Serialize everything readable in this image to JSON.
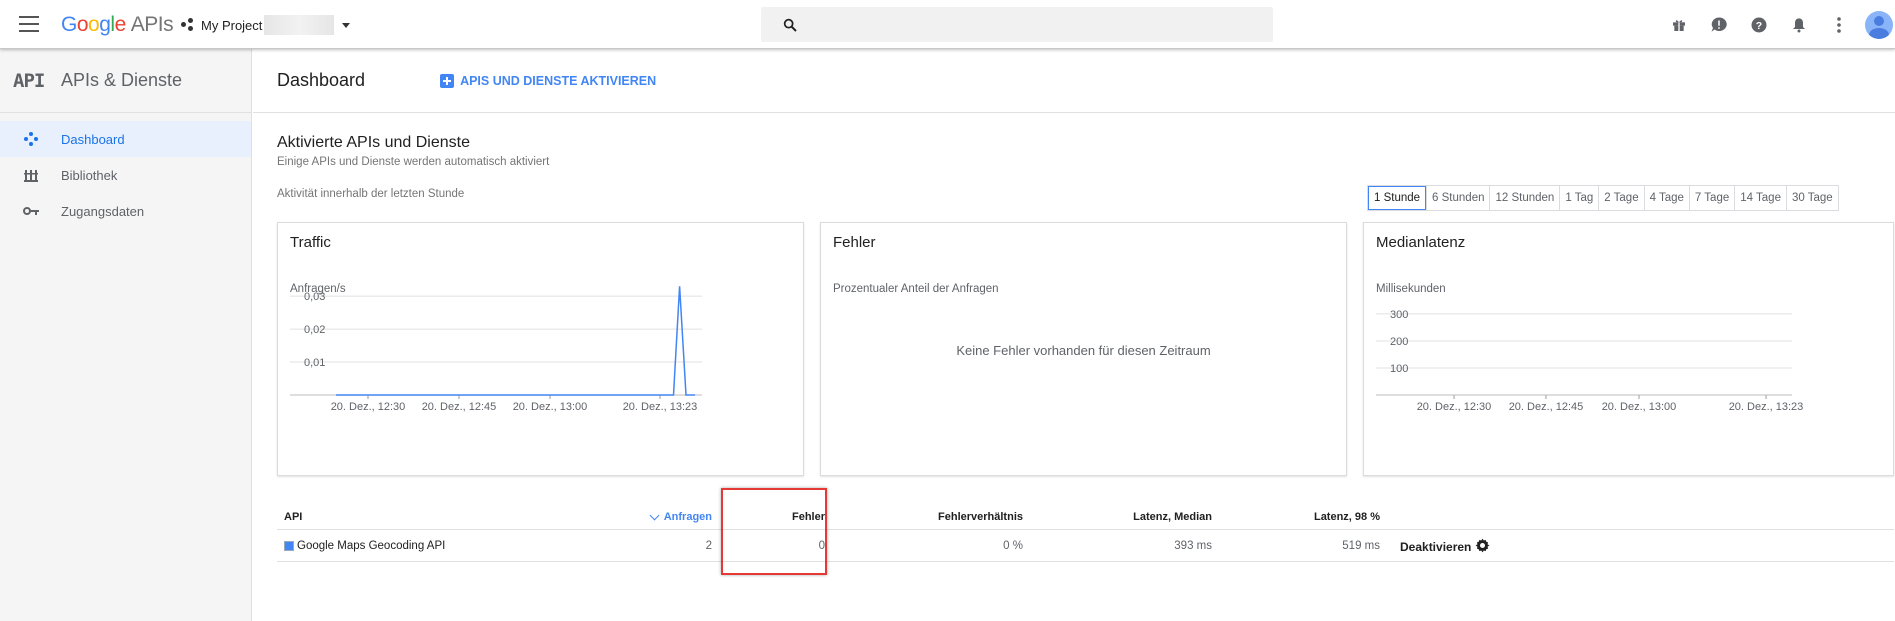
{
  "topbar": {
    "logo_word": "Google",
    "logo_suffix": "APIs",
    "project_name": "My Project",
    "icons": [
      "gift-icon",
      "feedback-icon",
      "help-icon",
      "notifications-icon",
      "more-vert-icon",
      "account-avatar-icon"
    ]
  },
  "sidebar": {
    "logo_text": "API",
    "title": "APIs & Dienste",
    "items": [
      {
        "label": "Dashboard",
        "icon": "dashboard-diamond-icon",
        "active": true
      },
      {
        "label": "Bibliothek",
        "icon": "library-icon",
        "active": false
      },
      {
        "label": "Zugangsdaten",
        "icon": "key-icon",
        "active": false
      }
    ]
  },
  "main": {
    "title": "Dashboard",
    "activate_label": "APIS UND DIENSTE AKTIVIEREN",
    "section_title": "Aktivierte APIs und Dienste",
    "section_subtitle": "Einige APIs und Dienste werden automatisch aktiviert",
    "activity_label": "Aktivität innerhalb der letzten Stunde",
    "time_ranges": [
      "1 Stunde",
      "6 Stunden",
      "12 Stunden",
      "1 Tag",
      "2 Tage",
      "4 Tage",
      "7 Tage",
      "14 Tage",
      "30 Tage"
    ],
    "selected_range": "1 Stunde"
  },
  "cards": {
    "traffic": {
      "title": "Traffic",
      "unit": "Anfragen/s"
    },
    "errors": {
      "title": "Fehler",
      "unit": "Prozentualer Anteil der Anfragen",
      "empty_message": "Keine Fehler vorhanden für diesen Zeitraum"
    },
    "latency": {
      "title": "Medianlatenz",
      "unit": "Millisekunden"
    }
  },
  "chart_data": [
    {
      "type": "line",
      "title": "Traffic",
      "ylabel": "Anfragen/s",
      "ylim": [
        0,
        0.034
      ],
      "yticks": [
        "0,01",
        "0,02",
        "0,03"
      ],
      "ytick_values": [
        0.01,
        0.02,
        0.03
      ],
      "xticks": [
        "20. Dez., 12:30",
        "20. Dez., 12:45",
        "20. Dez., 13:00",
        "20. Dez., 13:23"
      ],
      "series": [
        {
          "points": [
            [
              0,
              0
            ],
            [
              0.94,
              0
            ],
            [
              0.957,
              0.033
            ],
            [
              0.975,
              0
            ],
            [
              1.0,
              0
            ]
          ]
        }
      ],
      "color": "#4285f4",
      "grid": true
    },
    {
      "type": "line",
      "title": "Medianlatenz",
      "ylabel": "Millisekunden",
      "ylim": [
        0,
        370
      ],
      "yticks": [
        "100",
        "200",
        "300"
      ],
      "ytick_values": [
        100,
        200,
        300
      ],
      "xticks": [
        "20. Dez., 12:30",
        "20. Dez., 12:45",
        "20. Dez., 13:00",
        "20. Dez., 13:23"
      ],
      "series": [],
      "grid": true
    }
  ],
  "table": {
    "headers": {
      "api": "API",
      "requests": "Anfragen",
      "errors": "Fehler",
      "error_ratio": "Fehlerverhältnis",
      "latency_median": "Latenz, Median",
      "latency_98": "Latenz, 98 %"
    },
    "rows": [
      {
        "api": "Google Maps Geocoding API",
        "requests": "2",
        "errors": "0",
        "error_ratio": "0 %",
        "latency_median": "393 ms",
        "latency_98": "519 ms",
        "action": "Deaktivieren"
      }
    ]
  },
  "colors": {
    "accent": "#4285f4",
    "highlight": "#e53935"
  }
}
